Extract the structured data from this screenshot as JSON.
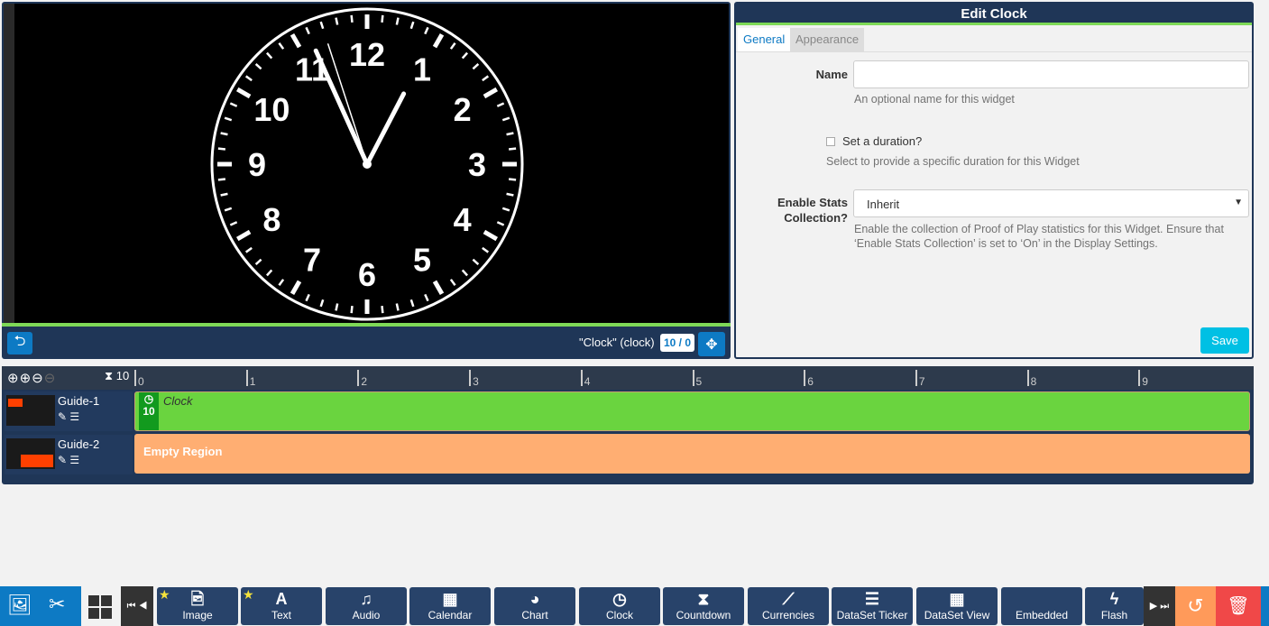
{
  "preview": {
    "widget_label": "\"Clock\" (clock)",
    "counter": "10 / 0",
    "clock_numbers": [
      "12",
      "1",
      "2",
      "3",
      "4",
      "5",
      "6",
      "7",
      "8",
      "9",
      "10",
      "11"
    ],
    "clock_time": {
      "hour": 12,
      "minute": 55,
      "second": 57
    }
  },
  "edit": {
    "title": "Edit Clock",
    "tabs": [
      {
        "label": "General",
        "active": true
      },
      {
        "label": "Appearance",
        "active": false
      }
    ],
    "name_label": "Name",
    "name_value": "",
    "name_help": "An optional name for this widget",
    "duration_label": "Set a duration?",
    "duration_checked": false,
    "duration_help": "Select to provide a specific duration for this Widget",
    "stats_label_1": "Enable Stats",
    "stats_label_2": "Collection?",
    "stats_value": "Inherit",
    "stats_help": "Enable the collection of Proof of Play statistics for this Widget. Ensure that ‘Enable Stats Collection’ is set to ‘On’ in the Display Settings.",
    "save_label": "Save"
  },
  "timeline": {
    "duration": "10",
    "ticks": [
      "0",
      "1",
      "2",
      "3",
      "4",
      "5",
      "6",
      "7",
      "8",
      "9"
    ],
    "regions": [
      {
        "name": "Guide-1",
        "widget": "Clock",
        "widget_duration": "10"
      },
      {
        "name": "Guide-2",
        "empty_label": "Empty Region"
      }
    ]
  },
  "toolbar": {
    "widgets": [
      {
        "label": "Image",
        "icon": "image-icon",
        "fav": true
      },
      {
        "label": "Text",
        "icon": "text-icon",
        "fav": true
      },
      {
        "label": "Audio",
        "icon": "audio-icon"
      },
      {
        "label": "Calendar",
        "icon": "calendar-icon"
      },
      {
        "label": "Chart",
        "icon": "pie-chart-icon"
      },
      {
        "label": "Clock",
        "icon": "clock-icon"
      },
      {
        "label": "Countdown",
        "icon": "hourglass-icon"
      },
      {
        "label": "Currencies",
        "icon": "line-chart-icon"
      },
      {
        "label": "DataSet Ticker",
        "icon": "list-icon"
      },
      {
        "label": "DataSet View",
        "icon": "table-icon"
      },
      {
        "label": "Embedded",
        "icon": "code-icon"
      },
      {
        "label": "Flash",
        "icon": "bolt-icon"
      }
    ]
  },
  "colors": {
    "navy": "#1f3657",
    "accent_green": "#7ed957",
    "widget_green": "#6ad43f",
    "empty_orange": "#ffae72",
    "save": "#00c0e4",
    "undo": "#ff9a5a",
    "delete": "#f04848",
    "blue": "#0d7ac4"
  }
}
